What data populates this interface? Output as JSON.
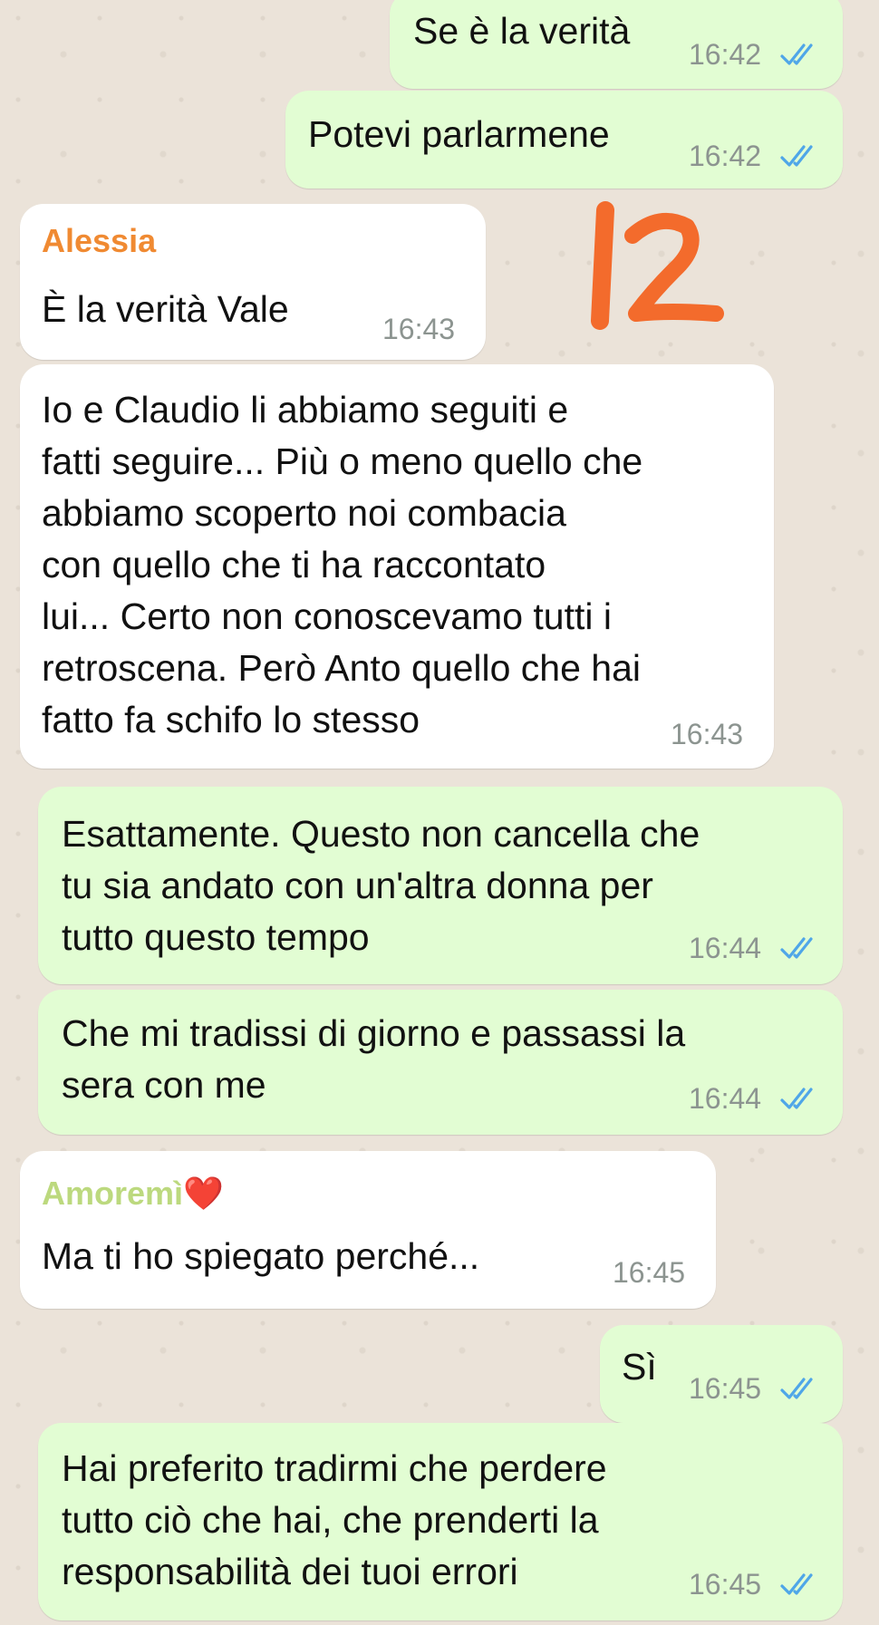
{
  "messages": [
    {
      "direction": "outgoing",
      "text": "Se è la verità",
      "time": "16:42",
      "status": "read"
    },
    {
      "direction": "outgoing",
      "text": "Potevi parlarmene",
      "time": "16:42",
      "status": "read"
    },
    {
      "direction": "incoming",
      "sender": "Alessia",
      "sender_color": "#f08a32",
      "text": "È la verità Vale",
      "time": "16:43"
    },
    {
      "direction": "incoming",
      "text": "Io e Claudio li abbiamo seguiti e\nfatti seguire... Più o meno quello che\nabbiamo scoperto noi combacia\ncon quello che ti ha raccontato\nlui... Certo non conoscevamo tutti i\nretroscena. Però Anto quello che hai\nfatto fa schifo lo stesso",
      "time": "16:43"
    },
    {
      "direction": "outgoing",
      "text": "Esattamente. Questo non cancella che\ntu sia andato con un'altra donna per\ntutto questo tempo",
      "time": "16:44",
      "status": "read"
    },
    {
      "direction": "outgoing",
      "text": "Che mi tradissi di giorno e passassi la\nsera con me",
      "time": "16:44",
      "status": "read"
    },
    {
      "direction": "incoming",
      "sender": "Amoremì",
      "sender_emoji": "❤️",
      "sender_color": "#bcd97e",
      "text": "Ma ti ho spiegato perché...",
      "time": "16:45"
    },
    {
      "direction": "outgoing",
      "text": "Sì",
      "time": "16:45",
      "status": "read"
    },
    {
      "direction": "outgoing",
      "text": "Hai preferito tradirmi che perdere\ntutto ciò che hai, che prenderti la\nresponsabilità dei tuoi errori",
      "time": "16:45",
      "status": "read"
    }
  ],
  "annotation": {
    "text": "12",
    "color": "#f36b2c"
  },
  "colors": {
    "outgoing_bubble": "#e2fdd3",
    "incoming_bubble": "#ffffff",
    "read_ticks": "#4fa6e8",
    "timestamp": "#8c9490"
  }
}
